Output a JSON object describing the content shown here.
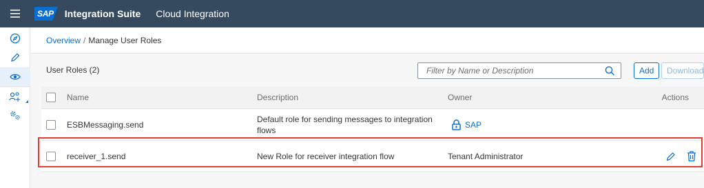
{
  "shellbar": {
    "logo_text": "SAP",
    "product": "Integration Suite",
    "subproduct": "Cloud Integration"
  },
  "sidenav": {
    "items": [
      {
        "icon": "discover-icon"
      },
      {
        "icon": "pencil-icon"
      },
      {
        "icon": "eye-icon",
        "active": true
      },
      {
        "icon": "user-settings-icon"
      },
      {
        "icon": "settings-icon"
      }
    ]
  },
  "breadcrumb": {
    "link": "Overview",
    "separator": "/",
    "current": "Manage User Roles"
  },
  "toolbar": {
    "title": "User Roles (2)",
    "search_placeholder": "Filter by Name or Description",
    "add_label": "Add",
    "download_label": "Download"
  },
  "table": {
    "columns": {
      "name": "Name",
      "description": "Description",
      "owner": "Owner",
      "actions": "Actions"
    },
    "rows": [
      {
        "name": "ESBMessaging.send",
        "description": "Default role for sending messages to integration flows",
        "owner": "SAP",
        "owner_locked": true
      },
      {
        "name": "receiver_1.send",
        "description": "New Role for receiver integration flow",
        "owner": "Tenant Administrator",
        "owner_locked": false
      }
    ]
  },
  "colors": {
    "shellbar": "#354a5f",
    "accent": "#0a6ed1",
    "highlight": "#e03c31"
  }
}
